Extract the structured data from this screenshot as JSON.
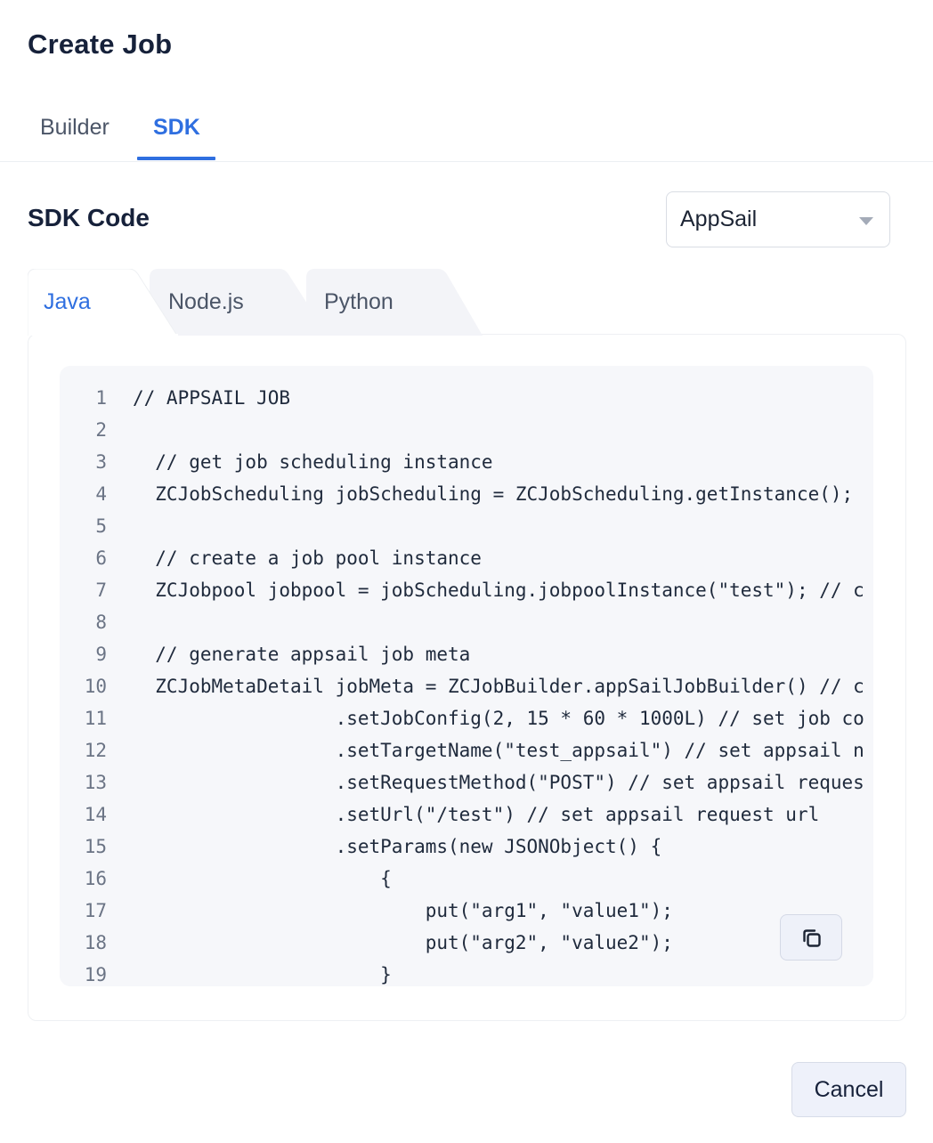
{
  "dialog": {
    "title": "Create Job"
  },
  "top_tabs": [
    {
      "label": "Builder",
      "active": false
    },
    {
      "label": "SDK",
      "active": true
    }
  ],
  "sdk": {
    "heading": "SDK Code",
    "target_select": {
      "value": "AppSail"
    },
    "language_tabs": [
      {
        "label": "Java",
        "active": true
      },
      {
        "label": "Node.js",
        "active": false
      },
      {
        "label": "Python",
        "active": false
      }
    ],
    "code_lines": [
      {
        "n": "1",
        "text": "// APPSAIL JOB"
      },
      {
        "n": "2",
        "text": ""
      },
      {
        "n": "3",
        "text": "  // get job scheduling instance"
      },
      {
        "n": "4",
        "text": "  ZCJobScheduling jobScheduling = ZCJobScheduling.getInstance();"
      },
      {
        "n": "5",
        "text": ""
      },
      {
        "n": "6",
        "text": "  // create a job pool instance"
      },
      {
        "n": "7",
        "text": "  ZCJobpool jobpool = jobScheduling.jobpoolInstance(\"test\"); // c"
      },
      {
        "n": "8",
        "text": ""
      },
      {
        "n": "9",
        "text": "  // generate appsail job meta"
      },
      {
        "n": "10",
        "text": "  ZCJobMetaDetail jobMeta = ZCJobBuilder.appSailJobBuilder() // c"
      },
      {
        "n": "11",
        "text": "                  .setJobConfig(2, 15 * 60 * 1000L) // set job co"
      },
      {
        "n": "12",
        "text": "                  .setTargetName(\"test_appsail\") // set appsail n"
      },
      {
        "n": "13",
        "text": "                  .setRequestMethod(\"POST\") // set appsail reques"
      },
      {
        "n": "14",
        "text": "                  .setUrl(\"/test\") // set appsail request url"
      },
      {
        "n": "15",
        "text": "                  .setParams(new JSONObject() {"
      },
      {
        "n": "16",
        "text": "                      {"
      },
      {
        "n": "17",
        "text": "                          put(\"arg1\", \"value1\");"
      },
      {
        "n": "18",
        "text": "                          put(\"arg2\", \"value2\");"
      },
      {
        "n": "19",
        "text": "                      }"
      }
    ],
    "copy_icon": "copy-icon"
  },
  "footer": {
    "cancel_label": "Cancel"
  }
}
